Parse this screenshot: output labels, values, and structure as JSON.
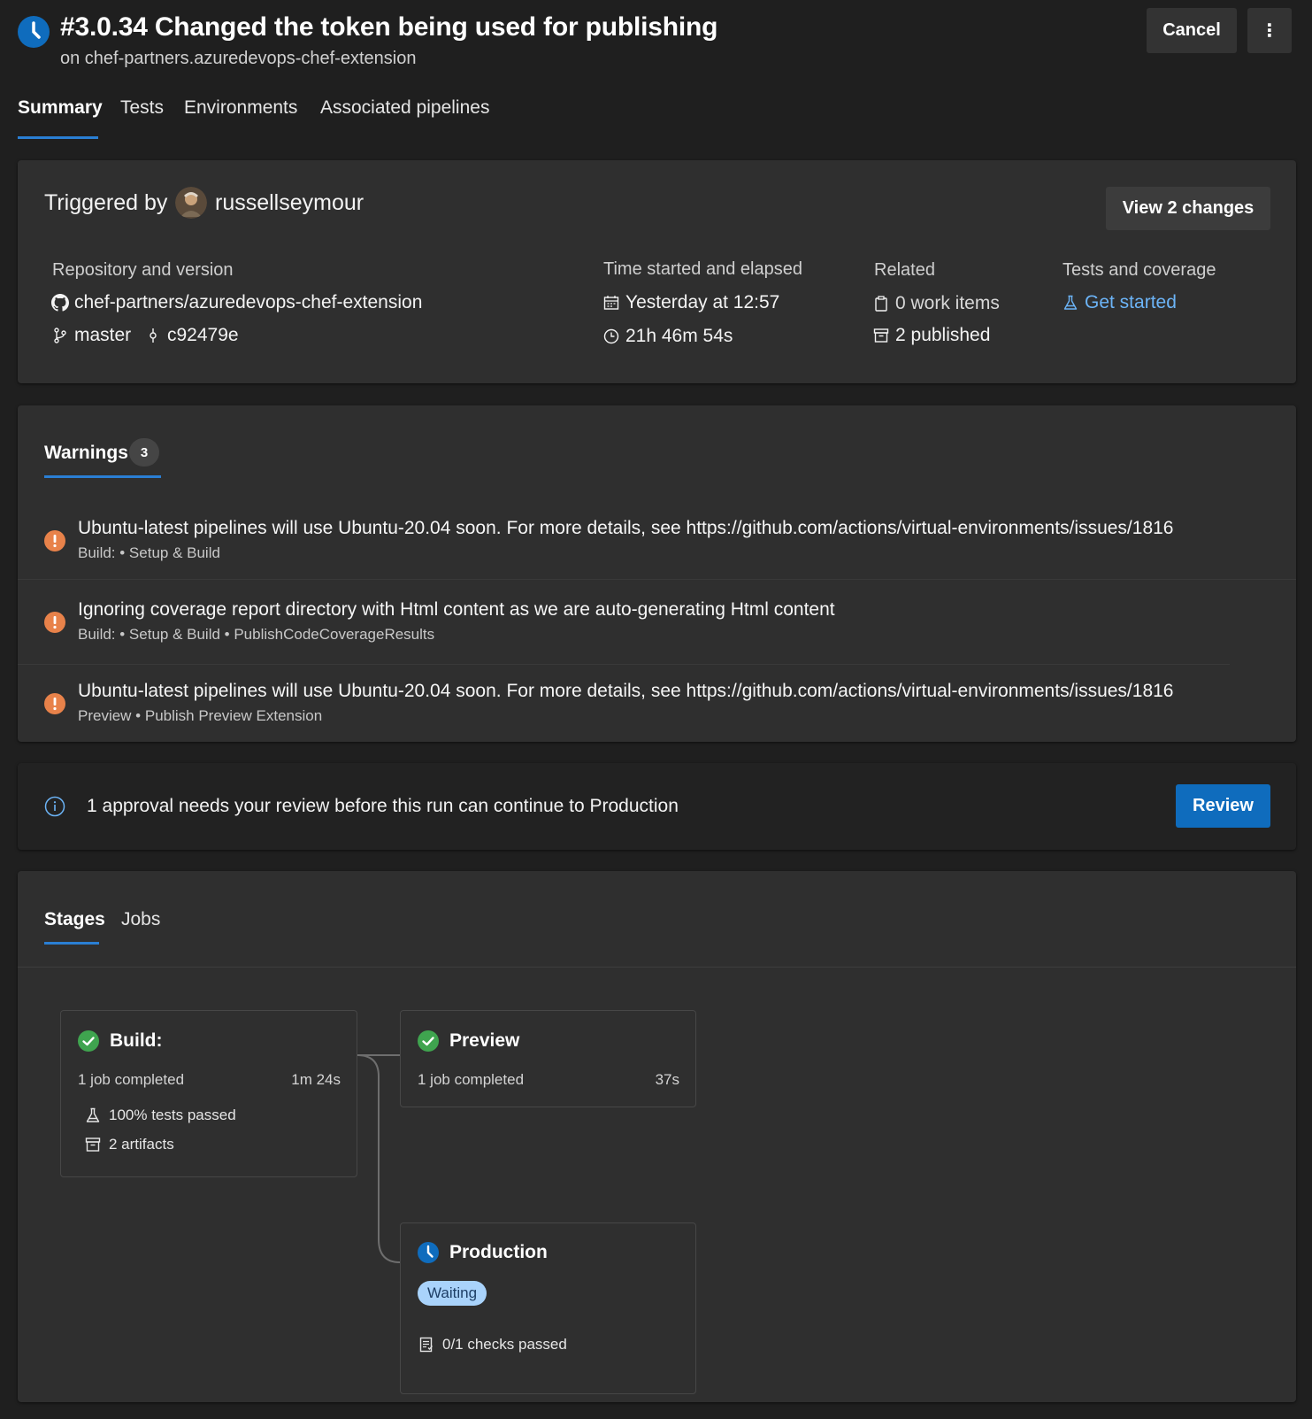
{
  "header": {
    "title": "#3.0.34 Changed the token being used for publishing",
    "subtitle": "on chef-partners.azuredevops-chef-extension",
    "cancel_label": "Cancel",
    "more_label": "⋮",
    "status_color": "#0f6cbd"
  },
  "tabs": [
    {
      "label": "Summary",
      "active": true
    },
    {
      "label": "Tests",
      "active": false
    },
    {
      "label": "Environments",
      "active": false
    },
    {
      "label": "Associated pipelines",
      "active": false
    }
  ],
  "summary": {
    "triggered_by_label": "Triggered by",
    "username": "russellseymour",
    "view_changes_label": "View 2 changes",
    "repository": {
      "label": "Repository and version",
      "repo_name": "chef-partners/azuredevops-chef-extension",
      "branch": "master",
      "commit": "c92479e"
    },
    "time": {
      "label": "Time started and elapsed",
      "started": "Yesterday at 12:57",
      "elapsed": "21h 46m 54s"
    },
    "related": {
      "label": "Related",
      "work_items": "0 work items",
      "published": "2 published"
    },
    "tests": {
      "label": "Tests and coverage",
      "link": "Get started"
    }
  },
  "warnings": {
    "tab_label": "Warnings",
    "count": "3",
    "items": [
      {
        "message": "Ubuntu-latest pipelines will use Ubuntu-20.04 soon. For more details, see https://github.com/actions/virtual-environments/issues/1816",
        "source": "Build: • Setup & Build"
      },
      {
        "message": "Ignoring coverage report directory with Html content as we are auto-generating Html content",
        "source": "Build: • Setup & Build • PublishCodeCoverageResults"
      },
      {
        "message": "Ubuntu-latest pipelines will use Ubuntu-20.04 soon. For more details, see https://github.com/actions/virtual-environments/issues/1816",
        "source": "Preview • Publish Preview Extension"
      }
    ],
    "warning_color": "#e8824a"
  },
  "approval": {
    "message": "1 approval needs your review before this run can continue to Production",
    "review_label": "Review"
  },
  "stages": {
    "tabs": [
      {
        "label": "Stages",
        "active": true
      },
      {
        "label": "Jobs",
        "active": false
      }
    ],
    "build": {
      "name": "Build:",
      "jobs": "1 job completed",
      "duration": "1m 24s",
      "tests": "100% tests passed",
      "artifacts": "2 artifacts"
    },
    "preview": {
      "name": "Preview",
      "jobs": "1 job completed",
      "duration": "37s"
    },
    "production": {
      "name": "Production",
      "status": "Waiting",
      "checks": "0/1 checks passed"
    },
    "success_color": "#3fa44f"
  }
}
